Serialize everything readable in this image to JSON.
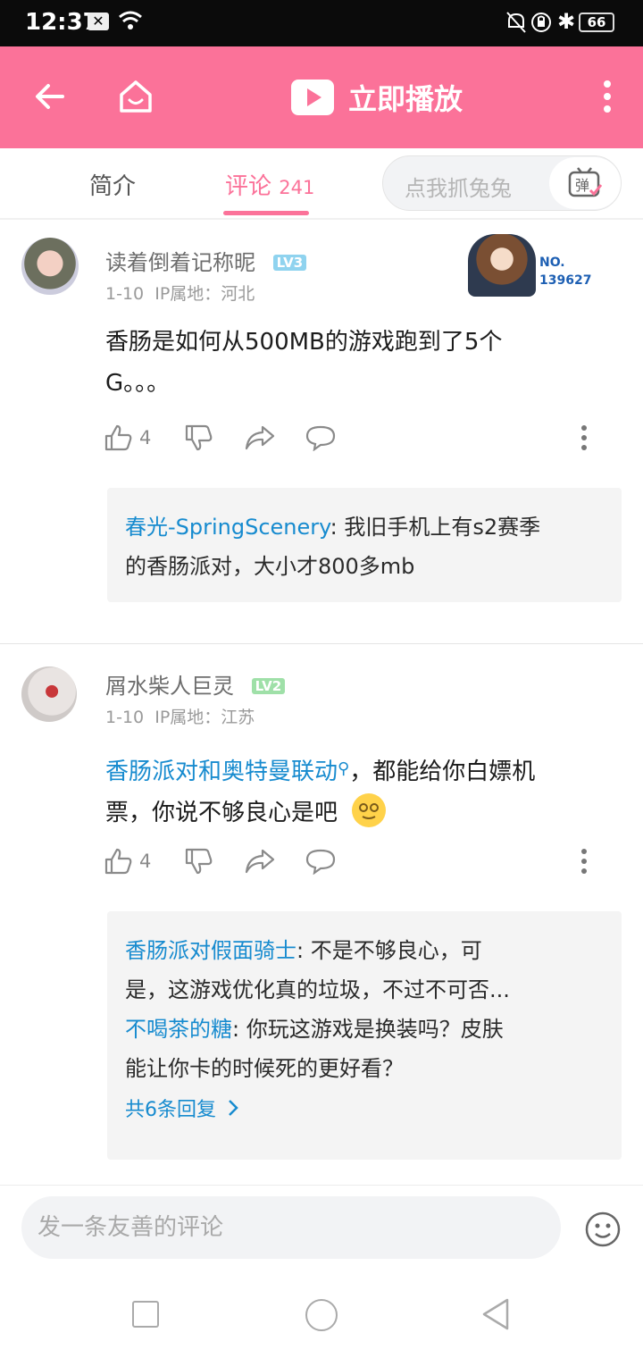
{
  "status_bar": {
    "time": "12:37",
    "battery": "66"
  },
  "app_bar": {
    "title": "立即播放"
  },
  "tabs": [
    {
      "label": "简介"
    },
    {
      "label": "评论",
      "count": "241"
    }
  ],
  "danmaku": {
    "placeholder": "点我抓兔兔",
    "button": "弹"
  },
  "comments": [
    {
      "username": "读着倒着记称昵",
      "level": "LV3",
      "date": "1-10",
      "ip": "IP属地：河北",
      "badge": {
        "no_label": "NO.",
        "number": "139627"
      },
      "text_line1": "香肠是如何从500MB的游戏跑到了5个",
      "text_line2": "G。。。",
      "likes": "4",
      "replies": [
        {
          "name": "春光-SpringScenery",
          "sep": ": ",
          "text1": "我旧手机上有s2赛季",
          "text2": "的香肠派对，大小才800多mb"
        }
      ]
    },
    {
      "username": "屑水柴人巨灵",
      "level": "LV2",
      "date": "1-10",
      "ip": "IP属地：江苏",
      "text_link": "香肠派对和奥特曼联动",
      "text_rest1": "，都能给你白嫖机",
      "text_line2": "票，你说不够良心是吧",
      "likes": "4",
      "replies": [
        {
          "name": "香肠派对假面骑士",
          "sep": ": ",
          "text1": "不是不够良心，可",
          "text2": "是，这游戏优化真的垃圾，不过不可否..."
        },
        {
          "name": "不喝茶的糖",
          "sep": ": ",
          "text1": "你玩这游戏是换装吗？皮肤",
          "text2": "能让你卡的时候死的更好看？"
        }
      ],
      "more_replies": "共6条回复"
    }
  ],
  "input_bar": {
    "placeholder": "发一条友善的评论"
  },
  "colors": {
    "accent": "#fb7299",
    "link": "#178bcf",
    "lv3": "#8fd3ef",
    "lv2": "#9fe0a8"
  }
}
